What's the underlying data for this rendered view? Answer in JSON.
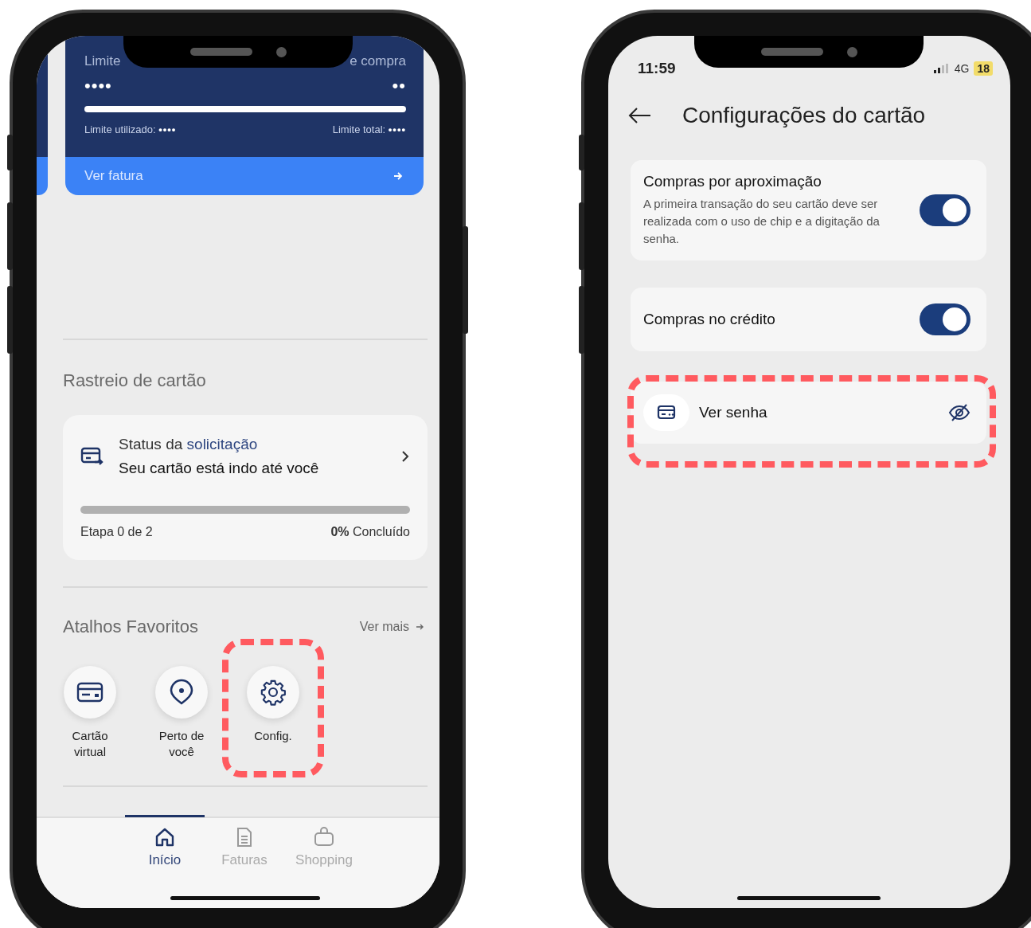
{
  "home_screen": {
    "credit_card": {
      "label_left": "Limite",
      "label_right": "e compra",
      "value_left": "••••",
      "value_right": "••",
      "used_label": "Limite utilizado:",
      "used_value": "••••",
      "total_label": "Limite total:",
      "total_value": "••••",
      "action": "Ver fatura"
    },
    "tracking": {
      "title": "Rastreio de cartão",
      "status_prefix": "Status da",
      "status_link": "solicitação",
      "message": "Seu cartão está indo até você",
      "level": 0,
      "step": "Etapa 0 de 2",
      "percent": "0%",
      "percent_suffix": "Concluído"
    },
    "shortcuts": {
      "title": "Atalhos Favoritos",
      "more": "Ver mais",
      "items": [
        {
          "kind": "card",
          "label": "Cartão virtual",
          "highlighted": false
        },
        {
          "kind": "pin",
          "label": "Perto de você",
          "highlighted": false
        },
        {
          "kind": "gear",
          "label": "Config.",
          "highlighted": true
        }
      ]
    },
    "nav": [
      {
        "kind": "home",
        "label": "Início",
        "selected": true
      },
      {
        "kind": "document",
        "label": "Faturas",
        "selected": false
      },
      {
        "kind": "bag",
        "label": "Shopping",
        "selected": false
      }
    ]
  },
  "settings_screen": {
    "status_bar": {
      "time": "11:59",
      "network": "4G",
      "battery": "18"
    },
    "title": "Configurações do cartão",
    "settings": [
      {
        "kind": "toggle",
        "title": "Compras por aproximação",
        "description": "A primeira transação do seu cartão deve ser realizada com o uso de chip e a digitação da senha.",
        "on": true,
        "highlighted": false
      },
      {
        "kind": "toggle",
        "title": "Compras no crédito",
        "on": true,
        "highlighted": false
      },
      {
        "kind": "link",
        "title": "Ver senha",
        "highlighted": true
      }
    ]
  }
}
